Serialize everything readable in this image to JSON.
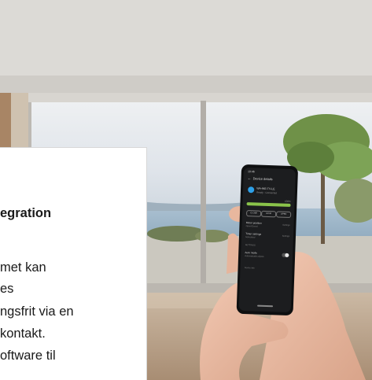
{
  "card": {
    "heading": "egration",
    "lines": [
      "met kan",
      "es",
      "ngsfrit via en",
      "kontakt.",
      "oftware til"
    ]
  },
  "phone": {
    "status_time": "10:46",
    "header_title": "Device details",
    "device_name": "WA-WE-TV-LE",
    "device_status": "Ready - Connected",
    "level_value": "100%",
    "pills": [
      "CLOSE",
      "STOP",
      "OPEN"
    ],
    "rows": [
      {
        "title": "Motor position",
        "sub": "Open/Closed",
        "value": "Settings"
      },
      {
        "title": "Timer settings",
        "sub": "Scheduled",
        "value": "Settings"
      }
    ],
    "section_label": "SETTINGS",
    "toggle_title": "Auto mode",
    "toggle_sub": "Automatically adjusts",
    "footer": "Device info"
  },
  "colors": {
    "accent_green": "#8ac34a",
    "accent_blue": "#2ea0e8",
    "phone_bg": "#1c1d1f"
  }
}
